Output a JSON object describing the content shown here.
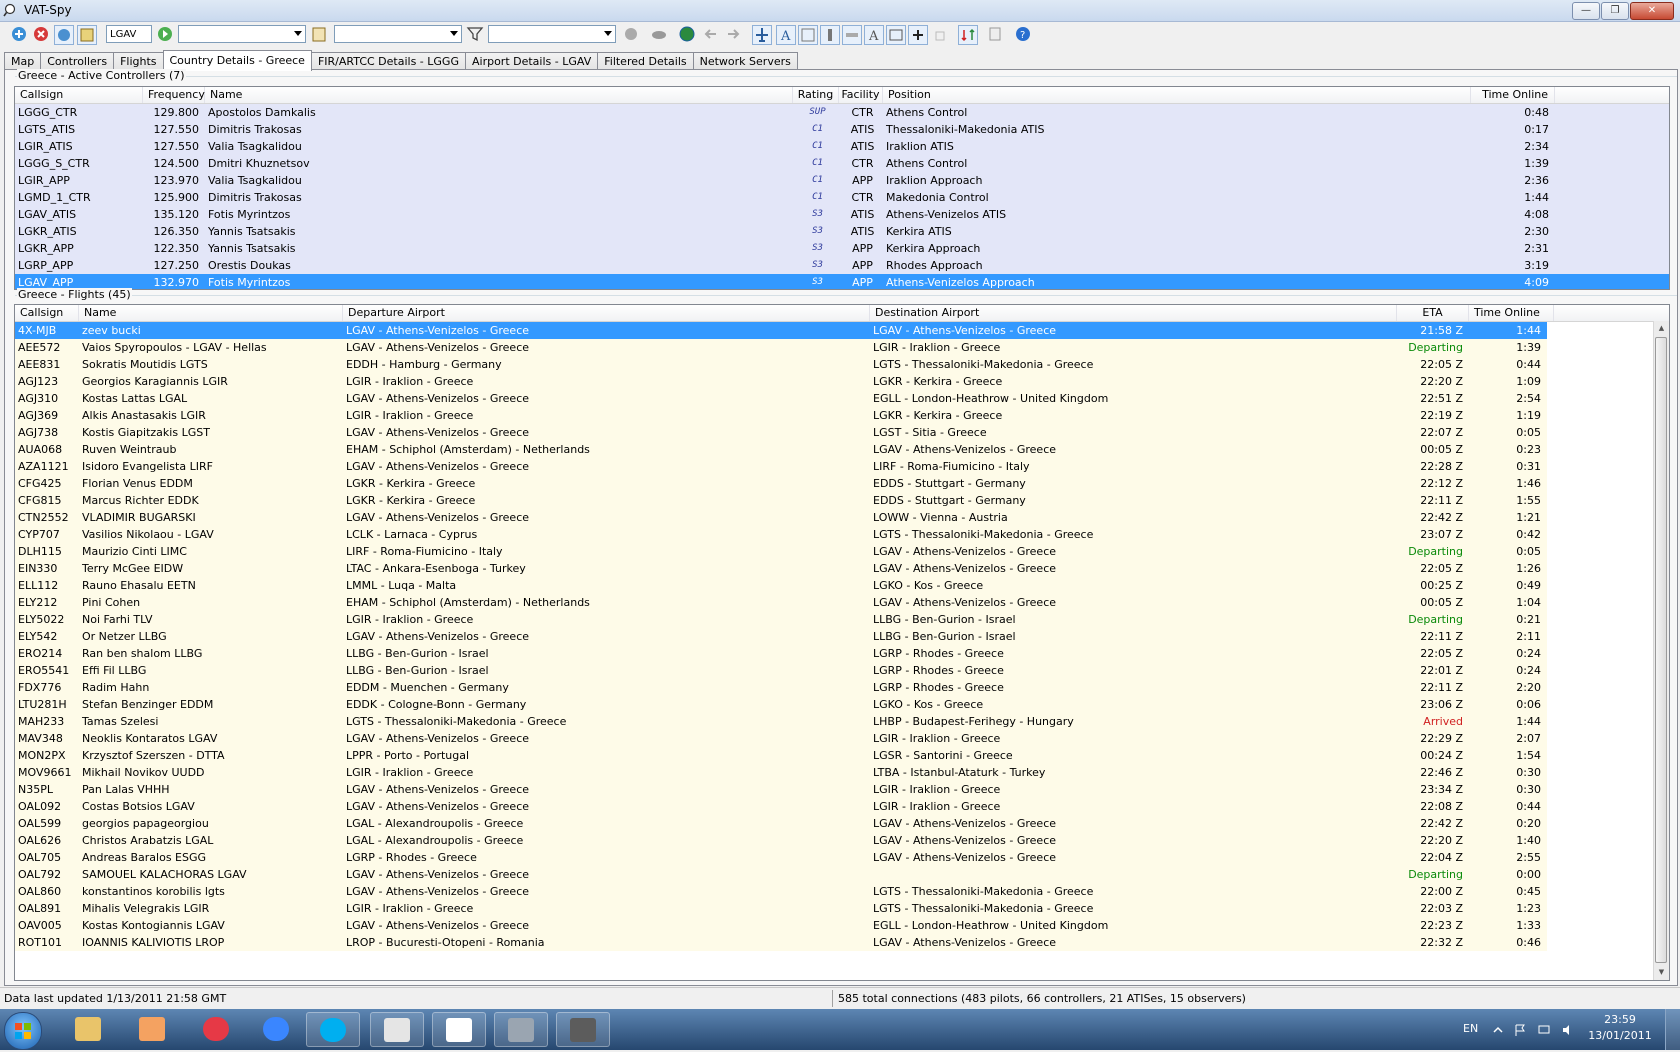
{
  "window": {
    "title": "VAT-Spy"
  },
  "toolbar": {
    "airport_input": "LGAV"
  },
  "tabs": [
    {
      "label": "Map",
      "active": false
    },
    {
      "label": "Controllers",
      "active": false
    },
    {
      "label": "Flights",
      "active": false
    },
    {
      "label": "Country Details - Greece",
      "active": true
    },
    {
      "label": "FIR/ARTCC Details - LGGG",
      "active": false
    },
    {
      "label": "Airport Details - LGAV",
      "active": false
    },
    {
      "label": "Filtered Details",
      "active": false
    },
    {
      "label": "Network Servers",
      "active": false
    }
  ],
  "controllers": {
    "group_title": "Greece - Active Controllers (7)",
    "columns": [
      "Callsign",
      "Frequency",
      "Name",
      "Rating",
      "Facility",
      "Position",
      "Time Online"
    ],
    "rows": [
      {
        "callsign": "LGGG_CTR",
        "frequency": "129.800",
        "name": "Apostolos Damkalis",
        "rating": "SUP",
        "facility": "CTR",
        "position": "Athens Control",
        "time": "0:48",
        "selected": false
      },
      {
        "callsign": "LGTS_ATIS",
        "frequency": "127.550",
        "name": "Dimitris Trakosas",
        "rating": "C1",
        "facility": "ATIS",
        "position": "Thessaloniki-Makedonia ATIS",
        "time": "0:17",
        "selected": false
      },
      {
        "callsign": "LGIR_ATIS",
        "frequency": "127.550",
        "name": "Valia Tsagkalidou",
        "rating": "C1",
        "facility": "ATIS",
        "position": "Iraklion ATIS",
        "time": "2:34",
        "selected": false
      },
      {
        "callsign": "LGGG_S_CTR",
        "frequency": "124.500",
        "name": "Dmitri Khuznetsov",
        "rating": "C1",
        "facility": "CTR",
        "position": "Athens Control",
        "time": "1:39",
        "selected": false
      },
      {
        "callsign": "LGIR_APP",
        "frequency": "123.970",
        "name": "Valia Tsagkalidou",
        "rating": "C1",
        "facility": "APP",
        "position": "Iraklion Approach",
        "time": "2:36",
        "selected": false
      },
      {
        "callsign": "LGMD_1_CTR",
        "frequency": "125.900",
        "name": "Dimitris Trakosas",
        "rating": "C1",
        "facility": "CTR",
        "position": "Makedonia Control",
        "time": "1:44",
        "selected": false
      },
      {
        "callsign": "LGAV_ATIS",
        "frequency": "135.120",
        "name": "Fotis Myrintzos",
        "rating": "S3",
        "facility": "ATIS",
        "position": "Athens-Venizelos ATIS",
        "time": "4:08",
        "selected": false
      },
      {
        "callsign": "LGKR_ATIS",
        "frequency": "126.350",
        "name": "Yannis Tsatsakis",
        "rating": "S3",
        "facility": "ATIS",
        "position": "Kerkira ATIS",
        "time": "2:30",
        "selected": false
      },
      {
        "callsign": "LGKR_APP",
        "frequency": "122.350",
        "name": "Yannis Tsatsakis",
        "rating": "S3",
        "facility": "APP",
        "position": "Kerkira Approach",
        "time": "2:31",
        "selected": false
      },
      {
        "callsign": "LGRP_APP",
        "frequency": "127.250",
        "name": "Orestis Doukas",
        "rating": "S3",
        "facility": "APP",
        "position": "Rhodes Approach",
        "time": "3:19",
        "selected": false
      },
      {
        "callsign": "LGAV_APP",
        "frequency": "132.970",
        "name": "Fotis Myrintzos",
        "rating": "S3",
        "facility": "APP",
        "position": "Athens-Venizelos Approach",
        "time": "4:09",
        "selected": true
      }
    ]
  },
  "flights": {
    "group_title": "Greece - Flights (45)",
    "columns": [
      "Callsign",
      "Name",
      "Departure Airport",
      "Destination Airport",
      "ETA",
      "Time Online"
    ],
    "rows": [
      {
        "callsign": "4X-MJB",
        "name": "zeev bucki",
        "dep": "LGAV - Athens-Venizelos - Greece",
        "dest": "LGAV - Athens-Venizelos - Greece",
        "eta": "21:58 Z",
        "time": "1:44",
        "status": "",
        "selected": true
      },
      {
        "callsign": "AEE572",
        "name": "Vaios Spyropoulos - LGAV - Hellas",
        "dep": "LGAV - Athens-Venizelos - Greece",
        "dest": "LGIR - Iraklion - Greece",
        "eta": "Departing",
        "time": "1:39",
        "status": "dep",
        "selected": false
      },
      {
        "callsign": "AEE831",
        "name": "Sokratis Moutidis LGTS",
        "dep": "EDDH - Hamburg - Germany",
        "dest": "LGTS - Thessaloniki-Makedonia - Greece",
        "eta": "22:05 Z",
        "time": "0:44",
        "status": "",
        "selected": false
      },
      {
        "callsign": "AGJ123",
        "name": "Georgios Karagiannis LGIR",
        "dep": "LGIR - Iraklion - Greece",
        "dest": "LGKR - Kerkira - Greece",
        "eta": "22:20 Z",
        "time": "1:09",
        "status": "",
        "selected": false
      },
      {
        "callsign": "AGJ310",
        "name": "Kostas Lattas LGAL",
        "dep": "LGAV - Athens-Venizelos - Greece",
        "dest": "EGLL - London-Heathrow - United Kingdom",
        "eta": "22:51 Z",
        "time": "2:54",
        "status": "",
        "selected": false
      },
      {
        "callsign": "AGJ369",
        "name": "Alkis Anastasakis LGIR",
        "dep": "LGIR - Iraklion - Greece",
        "dest": "LGKR - Kerkira - Greece",
        "eta": "22:19 Z",
        "time": "1:19",
        "status": "",
        "selected": false
      },
      {
        "callsign": "AGJ738",
        "name": "Kostis Giapitzakis LGST",
        "dep": "LGAV - Athens-Venizelos - Greece",
        "dest": "LGST - Sitia - Greece",
        "eta": "22:07 Z",
        "time": "0:05",
        "status": "",
        "selected": false
      },
      {
        "callsign": "AUA068",
        "name": "Ruven Weintraub",
        "dep": "EHAM - Schiphol (Amsterdam) - Netherlands",
        "dest": "LGAV - Athens-Venizelos - Greece",
        "eta": "00:05 Z",
        "time": "0:23",
        "status": "",
        "selected": false
      },
      {
        "callsign": "AZA1121",
        "name": "Isidoro Evangelista LIRF",
        "dep": "LGAV - Athens-Venizelos - Greece",
        "dest": "LIRF - Roma-Fiumicino - Italy",
        "eta": "22:28 Z",
        "time": "0:31",
        "status": "",
        "selected": false
      },
      {
        "callsign": "CFG425",
        "name": "Florian Venus EDDM",
        "dep": "LGKR - Kerkira - Greece",
        "dest": "EDDS - Stuttgart - Germany",
        "eta": "22:12 Z",
        "time": "1:46",
        "status": "",
        "selected": false
      },
      {
        "callsign": "CFG815",
        "name": "Marcus Richter EDDK",
        "dep": "LGKR - Kerkira - Greece",
        "dest": "EDDS - Stuttgart - Germany",
        "eta": "22:11 Z",
        "time": "1:55",
        "status": "",
        "selected": false
      },
      {
        "callsign": "CTN2552",
        "name": "VLADIMIR BUGARSKI",
        "dep": "LGAV - Athens-Venizelos - Greece",
        "dest": "LOWW - Vienna - Austria",
        "eta": "22:42 Z",
        "time": "1:21",
        "status": "",
        "selected": false
      },
      {
        "callsign": "CYP707",
        "name": "Vasilios Nikolaou - LGAV",
        "dep": "LCLK - Larnaca - Cyprus",
        "dest": "LGTS - Thessaloniki-Makedonia - Greece",
        "eta": "23:07 Z",
        "time": "0:42",
        "status": "",
        "selected": false
      },
      {
        "callsign": "DLH115",
        "name": "Maurizio Cinti LIMC",
        "dep": "LIRF - Roma-Fiumicino - Italy",
        "dest": "LGAV - Athens-Venizelos - Greece",
        "eta": "Departing",
        "time": "0:05",
        "status": "dep",
        "selected": false
      },
      {
        "callsign": "EIN330",
        "name": "Terry McGee EIDW",
        "dep": "LTAC - Ankara-Esenboga - Turkey",
        "dest": "LGAV - Athens-Venizelos - Greece",
        "eta": "22:05 Z",
        "time": "1:26",
        "status": "",
        "selected": false
      },
      {
        "callsign": "ELL112",
        "name": "Rauno Ehasalu EETN",
        "dep": "LMML - Luqa - Malta",
        "dest": "LGKO - Kos - Greece",
        "eta": "00:25 Z",
        "time": "0:49",
        "status": "",
        "selected": false
      },
      {
        "callsign": "ELY212",
        "name": "Pini Cohen",
        "dep": "EHAM - Schiphol (Amsterdam) - Netherlands",
        "dest": "LGAV - Athens-Venizelos - Greece",
        "eta": "00:05 Z",
        "time": "1:04",
        "status": "",
        "selected": false
      },
      {
        "callsign": "ELY5022",
        "name": "Noi Farhi TLV",
        "dep": "LGIR - Iraklion - Greece",
        "dest": "LLBG - Ben-Gurion - Israel",
        "eta": "Departing",
        "time": "0:21",
        "status": "dep",
        "selected": false
      },
      {
        "callsign": "ELY542",
        "name": "Or Netzer LLBG",
        "dep": "LGAV - Athens-Venizelos - Greece",
        "dest": "LLBG - Ben-Gurion - Israel",
        "eta": "22:11 Z",
        "time": "2:11",
        "status": "",
        "selected": false
      },
      {
        "callsign": "ERO214",
        "name": "Ran ben shalom LLBG",
        "dep": "LLBG - Ben-Gurion - Israel",
        "dest": "LGRP - Rhodes - Greece",
        "eta": "22:05 Z",
        "time": "0:24",
        "status": "",
        "selected": false
      },
      {
        "callsign": "ERO5541",
        "name": "Effi Fil LLBG",
        "dep": "LLBG - Ben-Gurion - Israel",
        "dest": "LGRP - Rhodes - Greece",
        "eta": "22:01 Z",
        "time": "0:24",
        "status": "",
        "selected": false
      },
      {
        "callsign": "FDX776",
        "name": "Radim Hahn",
        "dep": "EDDM - Muenchen - Germany",
        "dest": "LGRP - Rhodes - Greece",
        "eta": "22:11 Z",
        "time": "2:20",
        "status": "",
        "selected": false
      },
      {
        "callsign": "LTU281H",
        "name": "Stefan Benzinger EDDM",
        "dep": "EDDK - Cologne-Bonn - Germany",
        "dest": "LGKO - Kos - Greece",
        "eta": "23:06 Z",
        "time": "0:06",
        "status": "",
        "selected": false
      },
      {
        "callsign": "MAH233",
        "name": "Tamas Szelesi",
        "dep": "LGTS - Thessaloniki-Makedonia - Greece",
        "dest": "LHBP - Budapest-Ferihegy - Hungary",
        "eta": "Arrived",
        "time": "1:44",
        "status": "arr",
        "selected": false
      },
      {
        "callsign": "MAV348",
        "name": "Neoklis Kontaratos LGAV",
        "dep": "LGAV - Athens-Venizelos - Greece",
        "dest": "LGIR - Iraklion - Greece",
        "eta": "22:29 Z",
        "time": "2:07",
        "status": "",
        "selected": false
      },
      {
        "callsign": "MON2PX",
        "name": "Krzysztof Szerszen - DTTA",
        "dep": "LPPR - Porto - Portugal",
        "dest": "LGSR - Santorini - Greece",
        "eta": "00:24 Z",
        "time": "1:54",
        "status": "",
        "selected": false
      },
      {
        "callsign": "MOV9661",
        "name": "Mikhail Novikov UUDD",
        "dep": "LGIR - Iraklion - Greece",
        "dest": "LTBA - Istanbul-Ataturk - Turkey",
        "eta": "22:46 Z",
        "time": "0:30",
        "status": "",
        "selected": false
      },
      {
        "callsign": "N35PL",
        "name": "Pan Lalas VHHH",
        "dep": "LGAV - Athens-Venizelos - Greece",
        "dest": "LGIR - Iraklion - Greece",
        "eta": "23:34 Z",
        "time": "0:30",
        "status": "",
        "selected": false
      },
      {
        "callsign": "OAL092",
        "name": "Costas Botsios LGAV",
        "dep": "LGAV - Athens-Venizelos - Greece",
        "dest": "LGIR - Iraklion - Greece",
        "eta": "22:08 Z",
        "time": "0:44",
        "status": "",
        "selected": false
      },
      {
        "callsign": "OAL599",
        "name": "georgios papageorgiou",
        "dep": "LGAL - Alexandroupolis - Greece",
        "dest": "LGAV - Athens-Venizelos - Greece",
        "eta": "22:42 Z",
        "time": "0:20",
        "status": "",
        "selected": false
      },
      {
        "callsign": "OAL626",
        "name": "Christos Arabatzis LGAL",
        "dep": "LGAL - Alexandroupolis - Greece",
        "dest": "LGAV - Athens-Venizelos - Greece",
        "eta": "22:20 Z",
        "time": "1:40",
        "status": "",
        "selected": false
      },
      {
        "callsign": "OAL705",
        "name": "Andreas Baralos ESGG",
        "dep": "LGRP - Rhodes - Greece",
        "dest": "LGAV - Athens-Venizelos - Greece",
        "eta": "22:04 Z",
        "time": "2:55",
        "status": "",
        "selected": false
      },
      {
        "callsign": "OAL792",
        "name": "SAMOUEL KALACHORAS LGAV",
        "dep": "LGAV - Athens-Venizelos - Greece",
        "dest": "",
        "eta": "Departing",
        "time": "0:00",
        "status": "dep",
        "selected": false
      },
      {
        "callsign": "OAL860",
        "name": "konstantinos korobilis lgts",
        "dep": "LGAV - Athens-Venizelos - Greece",
        "dest": "LGTS - Thessaloniki-Makedonia - Greece",
        "eta": "22:00 Z",
        "time": "0:45",
        "status": "",
        "selected": false
      },
      {
        "callsign": "OAL891",
        "name": "Mihalis Velegrakis LGIR",
        "dep": "LGIR - Iraklion - Greece",
        "dest": "LGTS - Thessaloniki-Makedonia - Greece",
        "eta": "22:03 Z",
        "time": "1:23",
        "status": "",
        "selected": false
      },
      {
        "callsign": "OAV005",
        "name": "Kostas Kontogiannis LGAV",
        "dep": "LGAV - Athens-Venizelos - Greece",
        "dest": "EGLL - London-Heathrow - United Kingdom",
        "eta": "22:23 Z",
        "time": "1:33",
        "status": "",
        "selected": false
      },
      {
        "callsign": "ROT101",
        "name": "IOANNIS KALIVIOTIS LROP",
        "dep": "LROP - Bucuresti-Otopeni - Romania",
        "dest": "LGAV - Athens-Venizelos - Greece",
        "eta": "22:32 Z",
        "time": "0:46",
        "status": "",
        "selected": false
      }
    ]
  },
  "status": {
    "left": "Data last updated 1/13/2011 21:58 GMT",
    "right": "585 total connections (483 pilots, 66 controllers, 21 ATISes, 15 observers)"
  },
  "taskbar": {
    "lang": "EN",
    "time": "23:59",
    "date": "13/01/2011",
    "apps": [
      "explorer-icon",
      "media-player-icon",
      "chrome-icon",
      "internet-explorer-icon",
      "skype-icon",
      "mail-icon",
      "vatspy-icon",
      "teamspeak-icon",
      "printer-icon"
    ]
  },
  "colors": {
    "controller_row": "#e3e6f8",
    "flight_row": "#fefbe8",
    "selection": "#3399ff",
    "departing": "#0a8a0a",
    "arrived": "#d02020"
  }
}
